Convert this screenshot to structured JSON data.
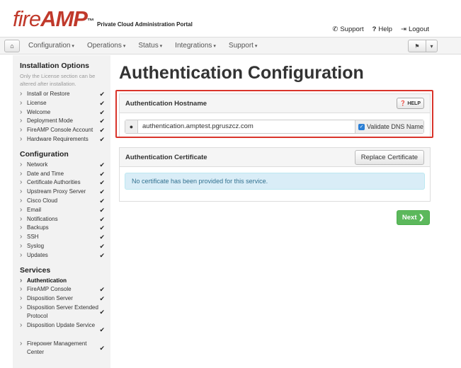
{
  "header": {
    "logo_fire": "fire",
    "logo_amp": "AMP",
    "logo_tm": "™",
    "portal_title": "Private Cloud Administration Portal",
    "support_label": "Support",
    "help_label": "Help",
    "logout_label": "Logout"
  },
  "nav": {
    "menus": [
      "Configuration",
      "Operations",
      "Status",
      "Integrations",
      "Support"
    ]
  },
  "sidebar": {
    "installation_heading": "Installation Options",
    "installation_note": "Only the License section can be altered after installation.",
    "installation_items": [
      "Install or Restore",
      "License",
      "Welcome",
      "Deployment Mode",
      "FireAMP Console Account",
      "Hardware Requirements"
    ],
    "configuration_heading": "Configuration",
    "configuration_items": [
      "Network",
      "Date and Time",
      "Certificate Authorities",
      "Upstream Proxy Server",
      "Cisco Cloud",
      "Email",
      "Notifications",
      "Backups",
      "SSH",
      "Syslog",
      "Updates"
    ],
    "services_heading": "Services",
    "services_items": [
      "Authentication",
      "FireAMP Console",
      "Disposition Server",
      "Disposition Server Extended Protocol",
      "Disposition Update Service",
      "Firepower Management Center"
    ]
  },
  "main": {
    "page_title": "Authentication Configuration",
    "hostname_panel_title": "Authentication Hostname",
    "help_button": "HELP",
    "hostname_value": "authentication.amptest.pgruszcz.com",
    "validate_dns_label": "Validate DNS Name",
    "validate_dns_checked": true,
    "certificate_panel_title": "Authentication Certificate",
    "replace_certificate_button": "Replace Certificate",
    "no_certificate_message": "No certificate has been provided for this service.",
    "next_button": "Next ❯"
  },
  "colors": {
    "brand_red": "#c0392b",
    "highlight_red": "#d9342b",
    "success_green": "#5cb85c",
    "info_blue_bg": "#d9edf7"
  }
}
